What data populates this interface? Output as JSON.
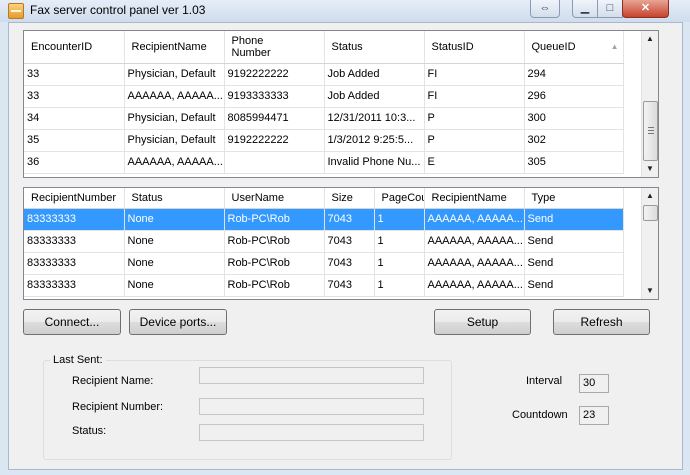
{
  "window": {
    "title": "Fax server control panel ver 1.03",
    "caption_buttons": {
      "swap": "⇔",
      "minimize": "▁",
      "maximize": "□",
      "close": "✕"
    }
  },
  "queue_grid": {
    "columns": [
      "EncounterID",
      "RecipientName",
      "Phone\nNumber",
      "Status",
      "StatusID",
      "QueueID"
    ],
    "sorted_column_icon": "sort-ascending-icon",
    "rows": [
      [
        "33",
        "Physician, Default",
        "9192222222",
        "Job Added",
        "FI",
        "294"
      ],
      [
        "33",
        "AAAAAA, AAAAA...",
        "9193333333",
        "Job Added",
        "FI",
        "296"
      ],
      [
        "34",
        "Physician, Default",
        "8085994471",
        "12/31/2011 10:3...",
        "P",
        "300"
      ],
      [
        "35",
        "Physician, Default",
        "9192222222",
        "1/3/2012 9:25:5...",
        "P",
        "302"
      ],
      [
        "36",
        "AAAAAA, AAAAA...",
        "",
        "Invalid Phone Nu...",
        "E",
        "305"
      ]
    ]
  },
  "sent_grid": {
    "columns": [
      "RecipientNumber",
      "Status",
      "UserName",
      "Size",
      "PageCou",
      "RecipientName",
      "Type"
    ],
    "selected_row": 0,
    "rows": [
      [
        "83333333",
        "None",
        "Rob-PC\\Rob",
        "7043",
        "1",
        "AAAAAA, AAAAA...",
        "Send"
      ],
      [
        "83333333",
        "None",
        "Rob-PC\\Rob",
        "7043",
        "1",
        "AAAAAA, AAAAA...",
        "Send"
      ],
      [
        "83333333",
        "None",
        "Rob-PC\\Rob",
        "7043",
        "1",
        "AAAAAA, AAAAA...",
        "Send"
      ],
      [
        "83333333",
        "None",
        "Rob-PC\\Rob",
        "7043",
        "1",
        "AAAAAA, AAAAA...",
        "Send"
      ]
    ]
  },
  "buttons": {
    "connect": "Connect...",
    "device_ports": "Device ports...",
    "setup": "Setup",
    "refresh": "Refresh"
  },
  "last_sent": {
    "title": "Last Sent:",
    "recipient_name_label": "Recipient Name:",
    "recipient_number_label": "Recipient Number:",
    "status_label": "Status:",
    "recipient_name": "",
    "recipient_number": "",
    "status": ""
  },
  "settings": {
    "interval_label": "Interval",
    "interval_value": "30",
    "countdown_label": "Countdown",
    "countdown_value": "23"
  },
  "colors": {
    "selection": "#3399ff",
    "titlebar": "#dbe6f3",
    "close_button": "#c6432c"
  }
}
